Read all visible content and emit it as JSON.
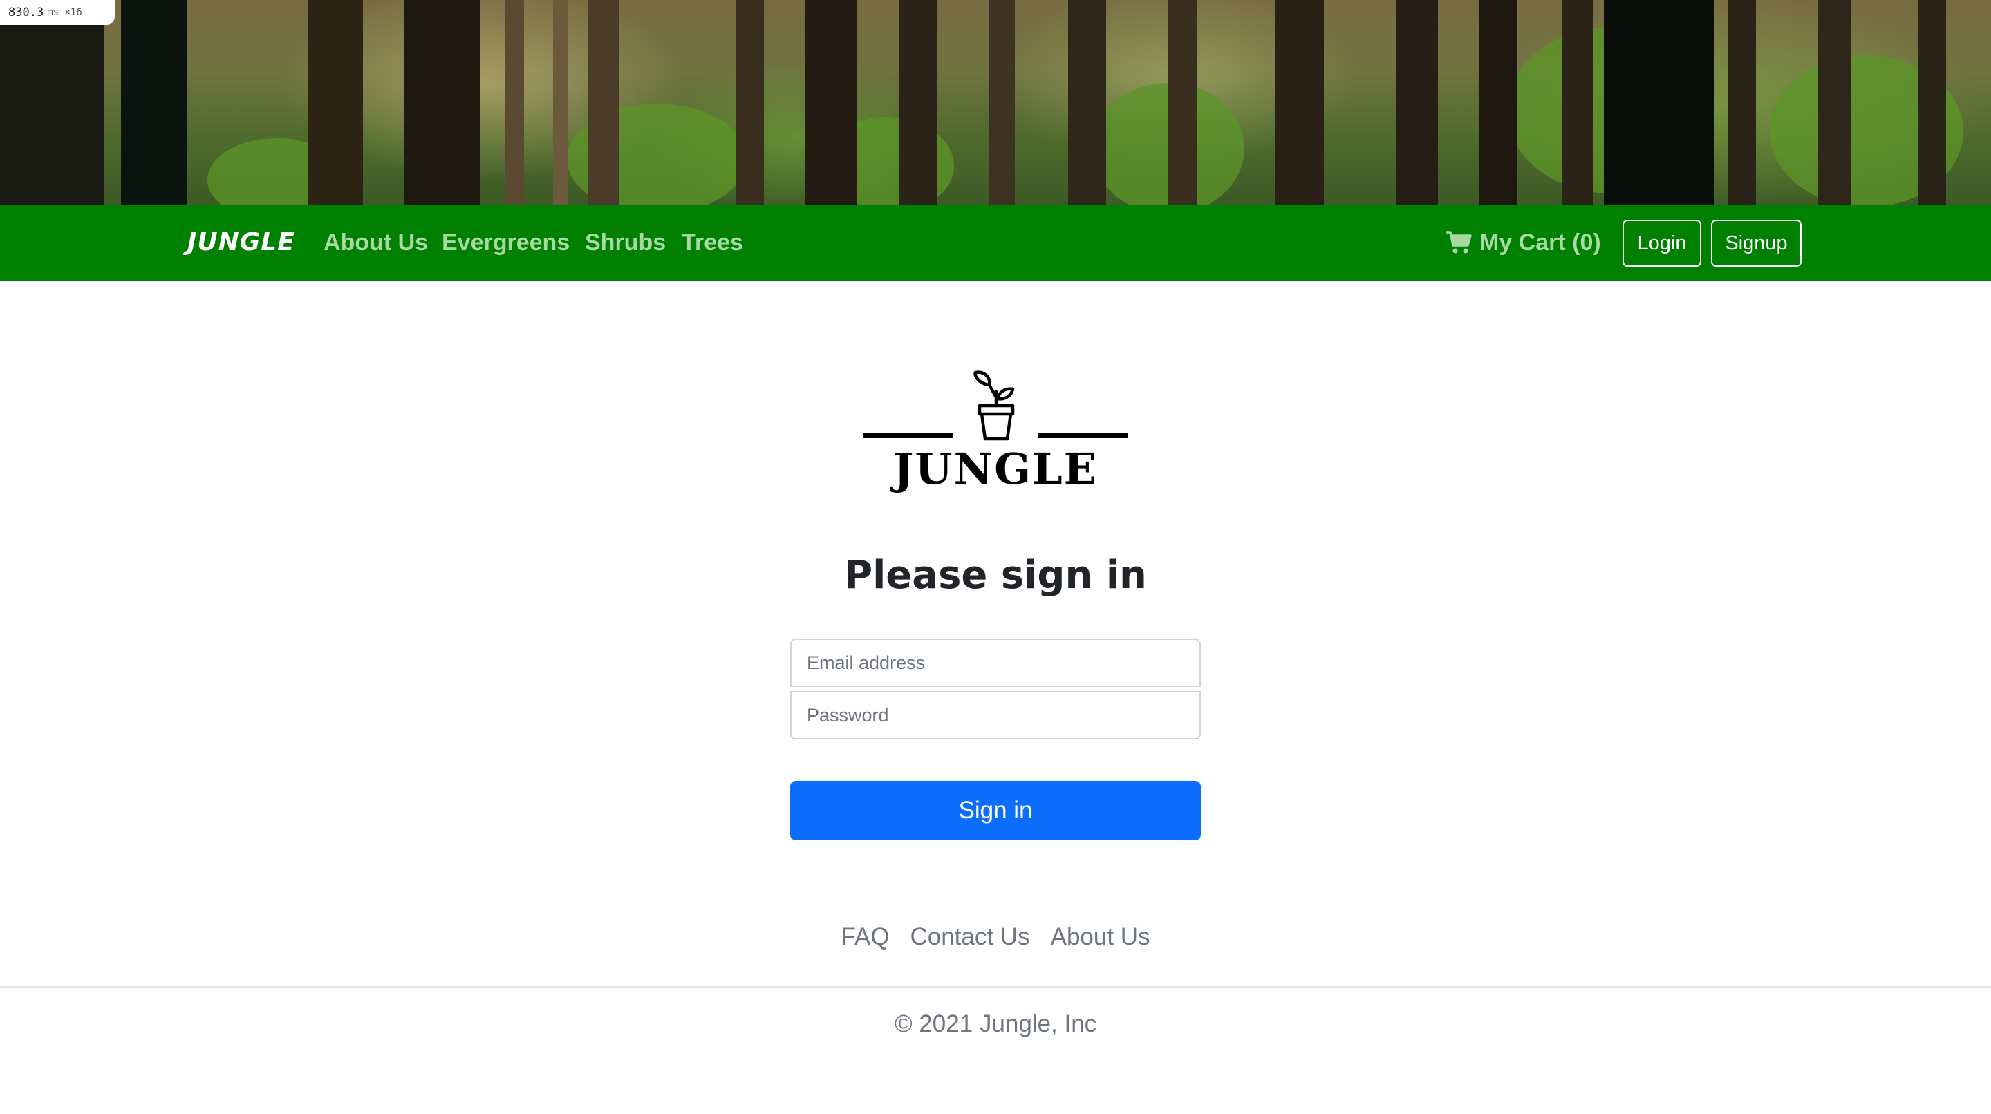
{
  "perf_badge": {
    "value": "830.3",
    "unit": "ms ×16"
  },
  "navbar": {
    "brand": "JUNGLE",
    "links": [
      {
        "label": "About Us"
      },
      {
        "label": "Evergreens"
      },
      {
        "label": "Shrubs"
      },
      {
        "label": "Trees"
      }
    ],
    "cart_label": "My Cart (0)",
    "cart_icon": "shopping-cart-icon",
    "login_label": "Login",
    "signup_label": "Signup",
    "background_color": "#008000",
    "link_color": "#a8d9a4"
  },
  "logo": {
    "wordmark": "JUNGLE",
    "icon": "potted-plant-icon"
  },
  "signin": {
    "heading": "Please sign in",
    "email_placeholder": "Email address",
    "password_placeholder": "Password",
    "submit_label": "Sign in",
    "submit_color": "#0d6efd"
  },
  "footer": {
    "links": [
      {
        "label": "FAQ"
      },
      {
        "label": "Contact Us"
      },
      {
        "label": "About Us"
      }
    ],
    "copyright": "© 2021 Jungle, Inc"
  }
}
